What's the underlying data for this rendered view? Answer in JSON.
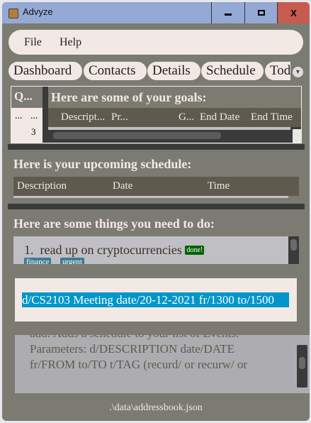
{
  "window": {
    "title": "Advyze",
    "close": "X"
  },
  "menu": [
    "File",
    "Help"
  ],
  "tabs": [
    "Dashboard",
    "Contacts",
    "Details",
    "Schedule",
    "Todo"
  ],
  "quick": {
    "header": "Q...",
    "row": [
      "...",
      "..."
    ],
    "num": "3"
  },
  "goals": {
    "title": "Here are some of your goals:",
    "columns": [
      "Descript...",
      "Pr...",
      "G...",
      "End Date",
      "End Time"
    ]
  },
  "schedule": {
    "title": "Here is your upcoming schedule:",
    "columns": [
      "Description",
      "Date",
      "Time"
    ]
  },
  "todo": {
    "title": "Here are some things you need to do:",
    "items": [
      {
        "index": "1.",
        "text": "read up on cryptocurrencies",
        "status": "done!",
        "tags": [
          "finance",
          "urgent"
        ]
      }
    ]
  },
  "command": {
    "value": "d/CS2103 Meeting date/20-12-2021 fr/1300 to/1500"
  },
  "result": {
    "lines": [
      "add: Adds a schedule to your list of Events.",
      "Parameters: d/DESCRIPTION date/DATE",
      "fr/FROM to/TO t/TAG (recurd/ or recurw/ or"
    ]
  },
  "status": {
    "path": ".\\data\\addressbook.json"
  },
  "colors": {
    "background": "#7c7b72",
    "titlebar": "#94a9d4",
    "close": "#c75b50",
    "highlight": "#0096c9",
    "done": "#006400",
    "tag": "#3e7b91"
  }
}
